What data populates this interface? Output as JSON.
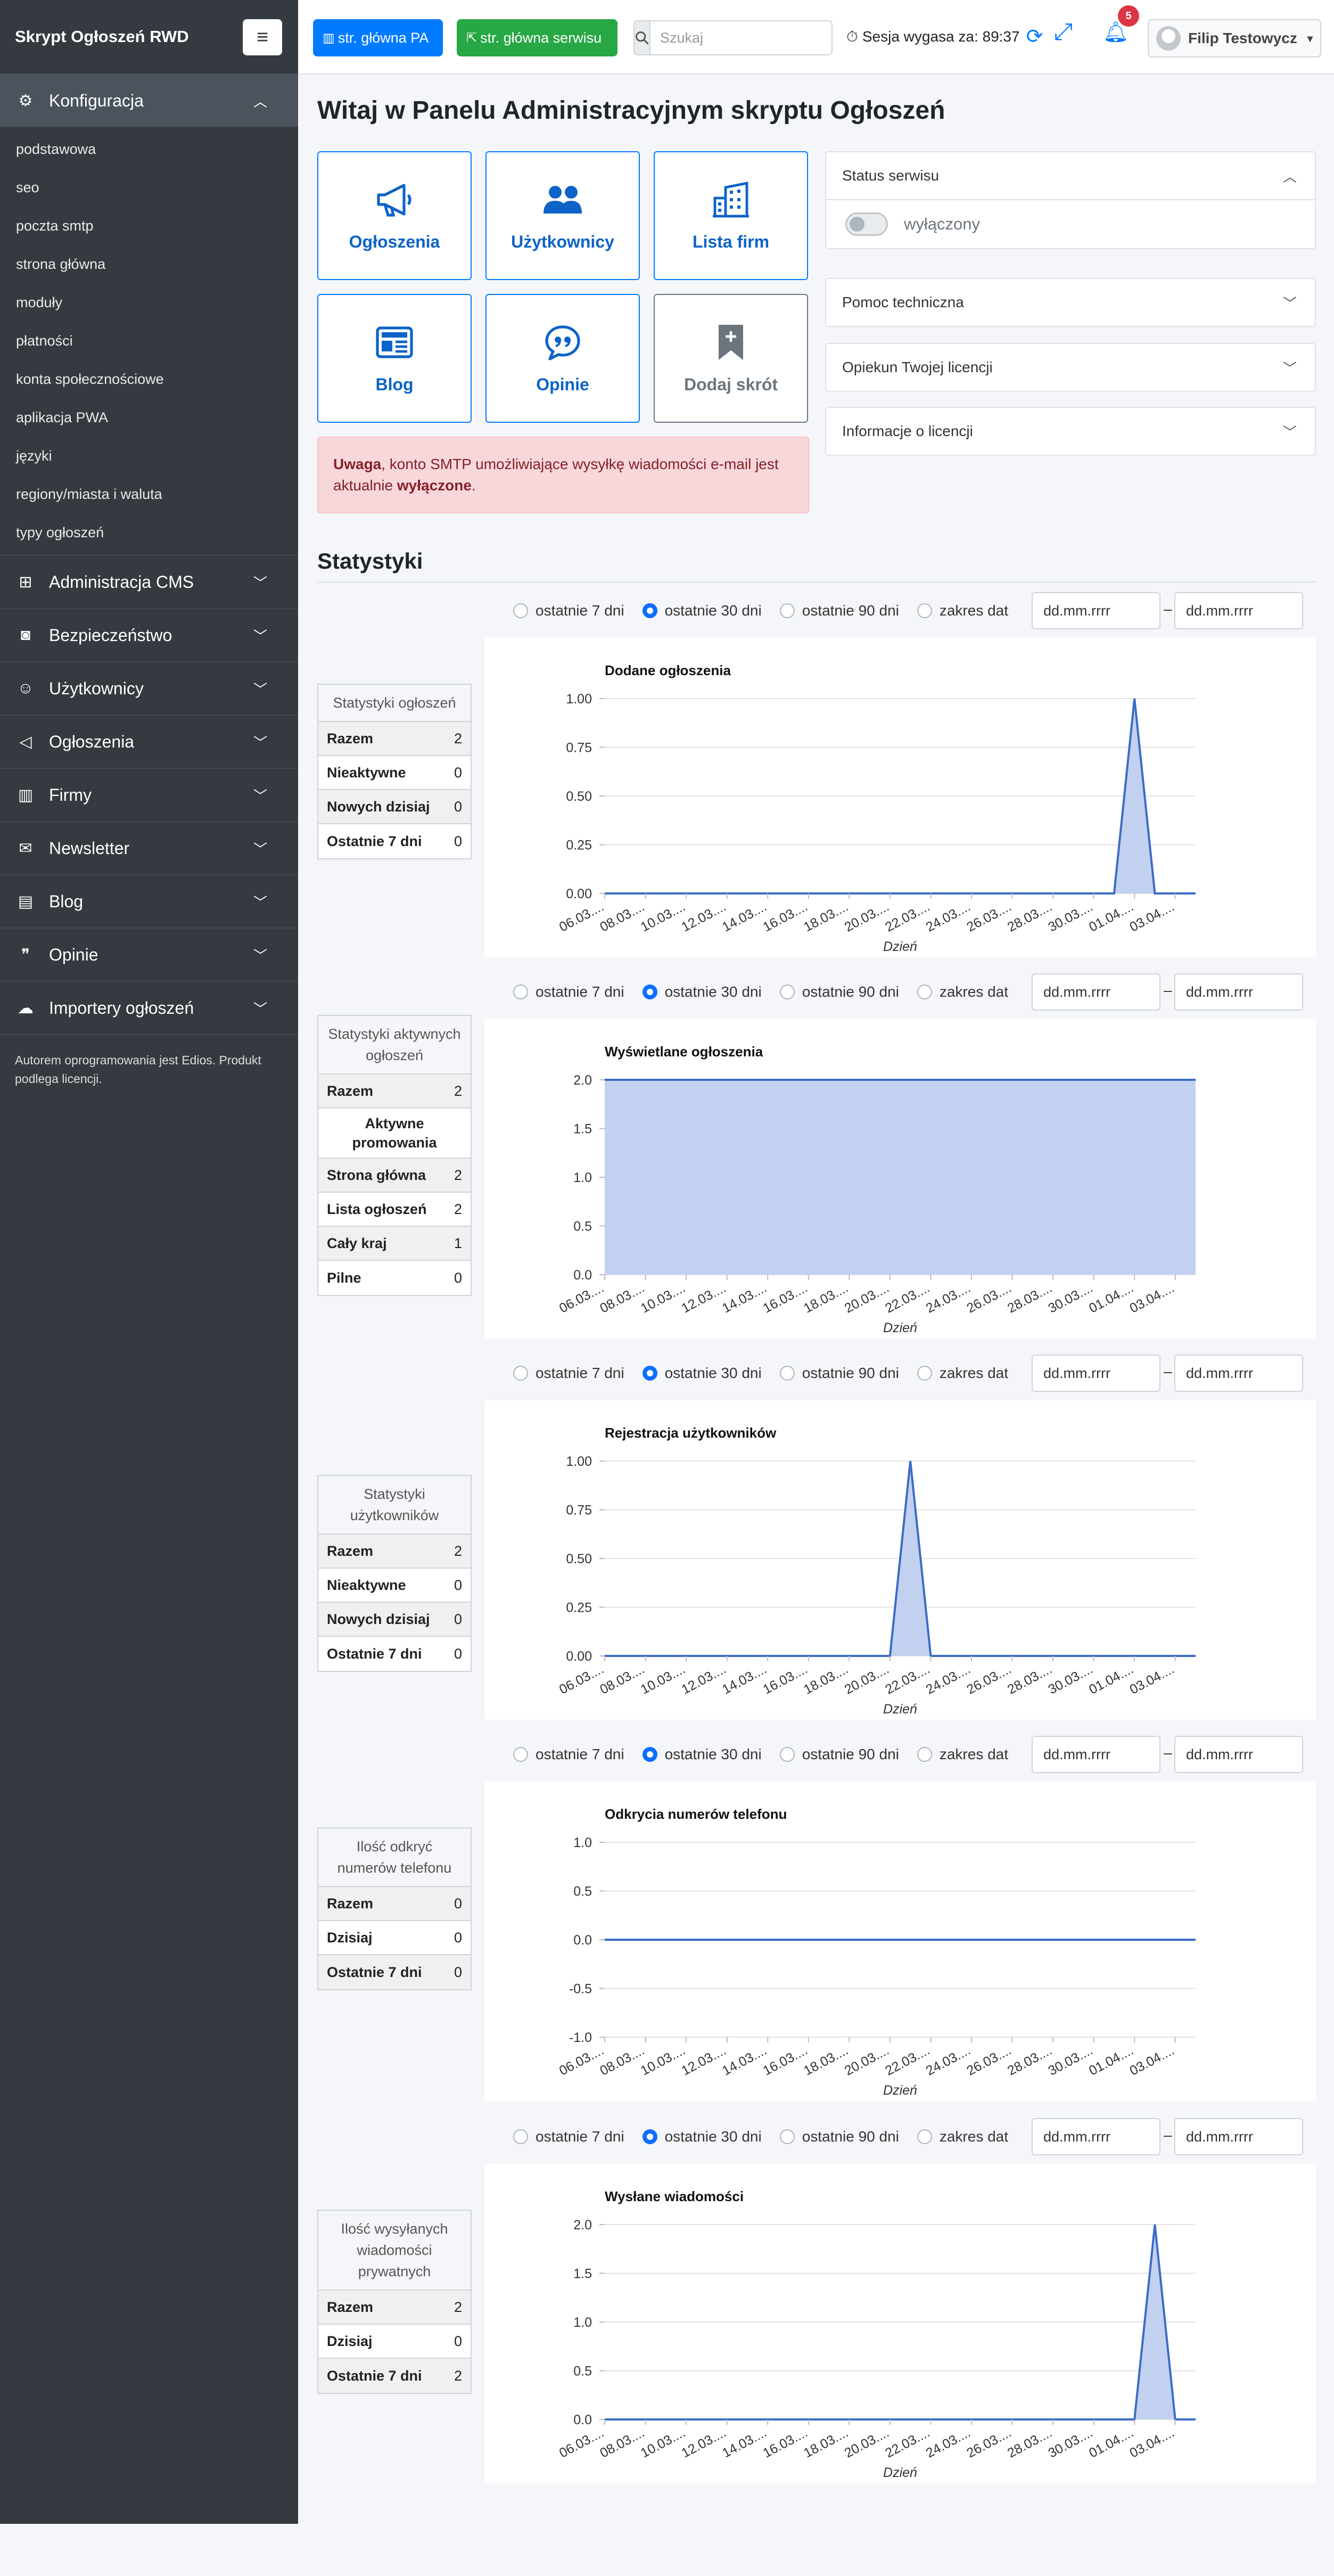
{
  "sidebar": {
    "brand": "Skrypt Ogłoszeń RWD",
    "open_menu": {
      "label": "Konfiguracja",
      "icon": "gear-icon"
    },
    "sub_items": [
      "podstawowa",
      "seo",
      "poczta smtp",
      "strona główna",
      "moduły",
      "płatności",
      "konta społecznościowe",
      "aplikacja PWA",
      "języki",
      "regiony/miasta i waluta",
      "typy ogłoszeń"
    ],
    "menu": [
      {
        "label": "Administracja CMS",
        "icon": "sitemap-icon"
      },
      {
        "label": "Bezpieczeństwo",
        "icon": "shield-icon"
      },
      {
        "label": "Użytkownicy",
        "icon": "users-icon"
      },
      {
        "label": "Ogłoszenia",
        "icon": "megaphone-icon"
      },
      {
        "label": "Firmy",
        "icon": "building-icon"
      },
      {
        "label": "Newsletter",
        "icon": "envelope-icon"
      },
      {
        "label": "Blog",
        "icon": "newspaper-icon"
      },
      {
        "label": "Opinie",
        "icon": "comment-quote-icon"
      },
      {
        "label": "Importery ogłoszeń",
        "icon": "cloud-upload-icon"
      }
    ],
    "footer": "Autorem oprogramowania jest Edios. Produkt podlega licencji."
  },
  "topbar": {
    "btn_pa": "str. główna PA",
    "btn_serwis": "str. główna serwisu",
    "search_placeholder": "Szukaj",
    "session": "Sesja wygasa za: 89:37",
    "notifications": "5",
    "user": "Filip Testowycz"
  },
  "page_title": "Witaj w Panelu Administracyjnym skryptu Ogłoszeń",
  "tiles": [
    "Ogłoszenia",
    "Użytkownicy",
    "Lista firm",
    "Blog",
    "Opinie",
    "Dodaj skrót"
  ],
  "alert": {
    "strong": "Uwaga",
    "text": ", konto SMTP umożliwiające wysyłkę wiadomości e-mail jest aktualnie ",
    "bold": "wyłączone",
    "end": "."
  },
  "accordion": {
    "status_title": "Status serwisu",
    "status_value": "wyłączony",
    "items": [
      "Pomoc techniczna",
      "Opiekun Twojej licencji",
      "Informacje o licencji"
    ]
  },
  "stats_title": "Statystyki",
  "filters": {
    "options": [
      "ostatnie 7 dni",
      "ostatnie 30 dni",
      "ostatnie 90 dni",
      "zakres dat"
    ],
    "selected": 1,
    "date_placeholder": "dd.mm.rrrr",
    "separator": "–"
  },
  "stat_tables": [
    {
      "title": "Statystyki ogłoszeń",
      "rows": [
        [
          "Razem",
          "2"
        ],
        [
          "Nieaktywne",
          "0"
        ],
        [
          "Nowych dzisiaj",
          "0"
        ],
        [
          "Ostatnie 7 dni",
          "0"
        ]
      ]
    },
    {
      "title": "Statystyki aktywnych ogłoszeń",
      "rows": [
        [
          "Razem",
          "2"
        ]
      ],
      "subtitle": "Aktywne promowania",
      "rows2": [
        [
          "Strona główna",
          "2"
        ],
        [
          "Lista ogłoszeń",
          "2"
        ],
        [
          "Cały kraj",
          "1"
        ],
        [
          "Pilne",
          "0"
        ]
      ]
    },
    {
      "title": "Statystyki użytkowników",
      "rows": [
        [
          "Razem",
          "2"
        ],
        [
          "Nieaktywne",
          "0"
        ],
        [
          "Nowych dzisiaj",
          "0"
        ],
        [
          "Ostatnie 7 dni",
          "0"
        ]
      ]
    },
    {
      "title": "Ilość odkryć numerów telefonu",
      "rows": [
        [
          "Razem",
          "0"
        ],
        [
          "Dzisiaj",
          "0"
        ],
        [
          "Ostatnie 7 dni",
          "0"
        ]
      ]
    },
    {
      "title": "Ilość wysyłanych wiadomości prywatnych",
      "rows": [
        [
          "Razem",
          "2"
        ],
        [
          "Dzisiaj",
          "0"
        ],
        [
          "Ostatnie 7 dni",
          "2"
        ]
      ]
    }
  ],
  "chart_data": [
    {
      "type": "area",
      "title": "Dodane ogłoszenia",
      "xlabel": "Dzień",
      "ylabel": "",
      "ylim": [
        0,
        1
      ],
      "yticks": [
        "0.00",
        "0.25",
        "0.50",
        "0.75",
        "1.00"
      ],
      "xticks": [
        "06.03....",
        "08.03....",
        "10.03....",
        "12.03....",
        "14.03....",
        "16.03....",
        "18.03....",
        "20.03....",
        "22.03....",
        "24.03....",
        "26.03....",
        "28.03....",
        "30.03....",
        "01.04....",
        "03.04...."
      ],
      "x": [
        0,
        1,
        2,
        3,
        4,
        5,
        6,
        7,
        8,
        9,
        10,
        11,
        12,
        13,
        14,
        15,
        16,
        17,
        18,
        19,
        20,
        21,
        22,
        23,
        24,
        25,
        26,
        27,
        28,
        29
      ],
      "values": [
        0,
        0,
        0,
        0,
        0,
        0,
        0,
        0,
        0,
        0,
        0,
        0,
        0,
        0,
        0,
        0,
        0,
        0,
        0,
        0,
        0,
        0,
        0,
        0,
        0,
        0,
        1,
        0,
        0,
        0
      ]
    },
    {
      "type": "area",
      "title": "Wyświetlane ogłoszenia",
      "xlabel": "Dzień",
      "ylabel": "",
      "ylim": [
        0,
        2
      ],
      "yticks": [
        "0.0",
        "0.5",
        "1.0",
        "1.5",
        "2.0"
      ],
      "xticks": [
        "06.03....",
        "08.03....",
        "10.03....",
        "12.03....",
        "14.03....",
        "16.03....",
        "18.03....",
        "20.03....",
        "22.03....",
        "24.03....",
        "26.03....",
        "28.03....",
        "30.03....",
        "01.04....",
        "03.04...."
      ],
      "x": [
        0,
        1,
        2,
        3,
        4,
        5,
        6,
        7,
        8,
        9,
        10,
        11,
        12,
        13,
        14,
        15,
        16,
        17,
        18,
        19,
        20,
        21,
        22,
        23,
        24,
        25,
        26,
        27,
        28,
        29
      ],
      "values": [
        2,
        2,
        2,
        2,
        2,
        2,
        2,
        2,
        2,
        2,
        2,
        2,
        2,
        2,
        2,
        2,
        2,
        2,
        2,
        2,
        2,
        2,
        2,
        2,
        2,
        2,
        2,
        2,
        2,
        2
      ]
    },
    {
      "type": "area",
      "title": "Rejestracja użytkowników",
      "xlabel": "Dzień",
      "ylabel": "",
      "ylim": [
        0,
        1
      ],
      "yticks": [
        "0.00",
        "0.25",
        "0.50",
        "0.75",
        "1.00"
      ],
      "xticks": [
        "06.03....",
        "08.03....",
        "10.03....",
        "12.03....",
        "14.03....",
        "16.03....",
        "18.03....",
        "20.03....",
        "22.03....",
        "24.03....",
        "26.03....",
        "28.03....",
        "30.03....",
        "01.04....",
        "03.04...."
      ],
      "x": [
        0,
        1,
        2,
        3,
        4,
        5,
        6,
        7,
        8,
        9,
        10,
        11,
        12,
        13,
        14,
        15,
        16,
        17,
        18,
        19,
        20,
        21,
        22,
        23,
        24,
        25,
        26,
        27,
        28,
        29
      ],
      "values": [
        0,
        0,
        0,
        0,
        0,
        0,
        0,
        0,
        0,
        0,
        0,
        0,
        0,
        0,
        0,
        1,
        0,
        0,
        0,
        0,
        0,
        0,
        0,
        0,
        0,
        0,
        0,
        0,
        0,
        0
      ]
    },
    {
      "type": "area",
      "title": "Odkrycia numerów telefonu",
      "xlabel": "Dzień",
      "ylabel": "",
      "ylim": [
        -1,
        1
      ],
      "yticks": [
        "-1.0",
        "-0.5",
        "0.0",
        "0.5",
        "1.0"
      ],
      "xticks": [
        "06.03....",
        "08.03....",
        "10.03....",
        "12.03....",
        "14.03....",
        "16.03....",
        "18.03....",
        "20.03....",
        "22.03....",
        "24.03....",
        "26.03....",
        "28.03....",
        "30.03....",
        "01.04....",
        "03.04...."
      ],
      "x": [
        0,
        1,
        2,
        3,
        4,
        5,
        6,
        7,
        8,
        9,
        10,
        11,
        12,
        13,
        14,
        15,
        16,
        17,
        18,
        19,
        20,
        21,
        22,
        23,
        24,
        25,
        26,
        27,
        28,
        29
      ],
      "values": [
        0,
        0,
        0,
        0,
        0,
        0,
        0,
        0,
        0,
        0,
        0,
        0,
        0,
        0,
        0,
        0,
        0,
        0,
        0,
        0,
        0,
        0,
        0,
        0,
        0,
        0,
        0,
        0,
        0,
        0
      ]
    },
    {
      "type": "area",
      "title": "Wysłane wiadomości",
      "xlabel": "Dzień",
      "ylabel": "",
      "ylim": [
        0,
        2
      ],
      "yticks": [
        "0.0",
        "0.5",
        "1.0",
        "1.5",
        "2.0"
      ],
      "xticks": [
        "06.03....",
        "08.03....",
        "10.03....",
        "12.03....",
        "14.03....",
        "16.03....",
        "18.03....",
        "20.03....",
        "22.03....",
        "24.03....",
        "26.03....",
        "28.03....",
        "30.03....",
        "01.04....",
        "03.04...."
      ],
      "x": [
        0,
        1,
        2,
        3,
        4,
        5,
        6,
        7,
        8,
        9,
        10,
        11,
        12,
        13,
        14,
        15,
        16,
        17,
        18,
        19,
        20,
        21,
        22,
        23,
        24,
        25,
        26,
        27,
        28,
        29
      ],
      "values": [
        0,
        0,
        0,
        0,
        0,
        0,
        0,
        0,
        0,
        0,
        0,
        0,
        0,
        0,
        0,
        0,
        0,
        0,
        0,
        0,
        0,
        0,
        0,
        0,
        0,
        0,
        0,
        2,
        0,
        0
      ]
    }
  ],
  "colors": {
    "primary": "#007bff",
    "success": "#28a745",
    "sidebar": "#343a40",
    "area_fill": "#c3d1f0",
    "line": "#3c6cc6"
  }
}
